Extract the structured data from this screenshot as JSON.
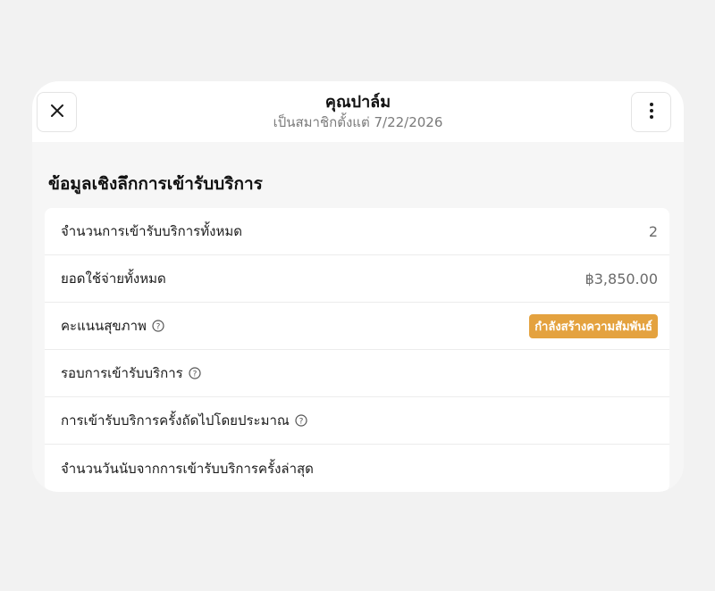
{
  "header": {
    "title": "คุณปาล์ม",
    "subtitle": "เป็นสมาชิกตั้งแต่ 7/22/2026",
    "close_icon": "close-icon",
    "more_icon": "more-vertical-icon"
  },
  "section": {
    "title": "ข้อมูลเชิงลึกการเข้ารับบริการ"
  },
  "rows": [
    {
      "label": "จำนวนการเข้ารับบริการทั้งหมด",
      "value": "2"
    },
    {
      "label": "ยอดใช้จ่ายทั้งหมด",
      "value": "฿3,850.00"
    },
    {
      "label": "คะแนนสุขภาพ",
      "badge": "กำลังสร้างความสัมพันธ์",
      "badge_color": "#e4a23f",
      "info_icon": "info-circle-icon"
    },
    {
      "label": "รอบการเข้ารับบริการ",
      "info_icon": "info-circle-icon"
    },
    {
      "label": "การเข้ารับบริการครั้งถัดไปโดยประมาณ",
      "info_icon": "info-circle-icon"
    },
    {
      "label": "จำนวนวันนับจากการเข้ารับบริการครั้งล่าสุด"
    }
  ]
}
